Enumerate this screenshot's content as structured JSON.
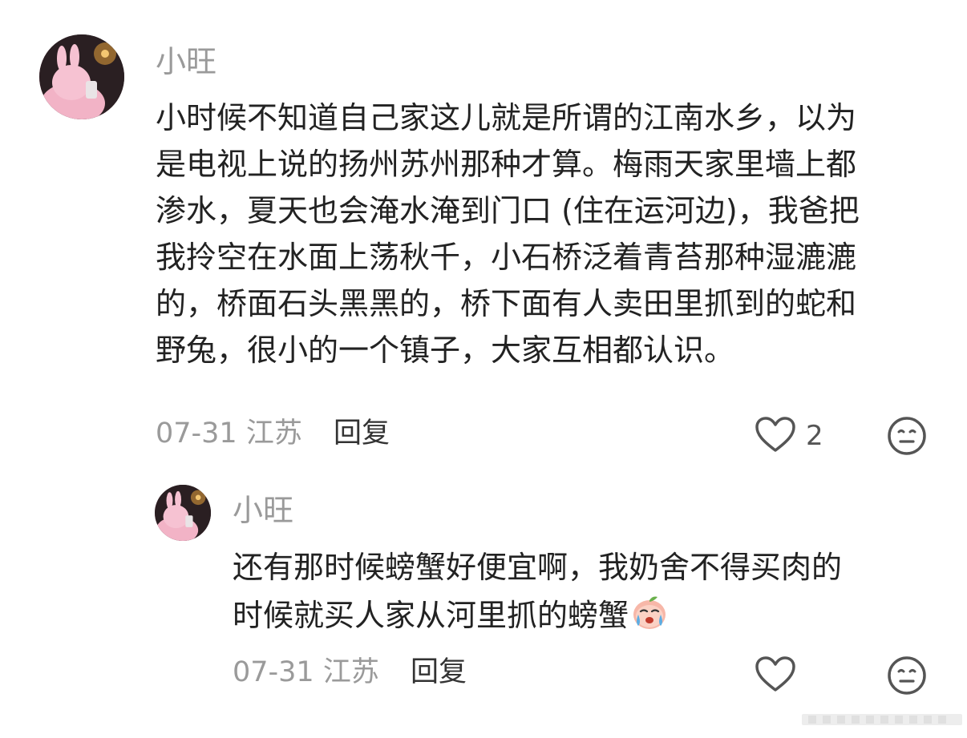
{
  "comments": [
    {
      "username": "小旺",
      "lines": [
        "小时候不知道自己家这儿就是所谓的江南水乡，以为",
        "是电视上说的扬州苏州那种才算。梅雨天家里墙上都",
        "渗水，夏天也会淹水淹到门口 (住在运河边)，我爸把",
        "我拎空在水面上荡秋千，小石桥泛着青苔那种湿漉漉",
        "的，桥面石头黑黑的，桥下面有人卖田里抓到的蛇和",
        "野兔，很小的一个镇子，大家互相都认识。"
      ],
      "date_location": "07-31 江苏",
      "reply_label": "回复",
      "like_count": "2"
    },
    {
      "username": "小旺",
      "lines": [
        "还有那时候螃蟹好便宜啊，我奶舍不得买肉的",
        "时候就买人家从河里抓的螃蟹"
      ],
      "date_location": "07-31 江苏",
      "reply_label": "回复",
      "like_count": ""
    }
  ],
  "icons": {
    "like": "heart-outline-icon",
    "dislike": "meh-face-icon",
    "inline_emoji": "crying-peach-emoji"
  },
  "colors": {
    "text_primary": "#222222",
    "text_secondary": "#9a9a9a",
    "icon_stroke": "#555555"
  }
}
